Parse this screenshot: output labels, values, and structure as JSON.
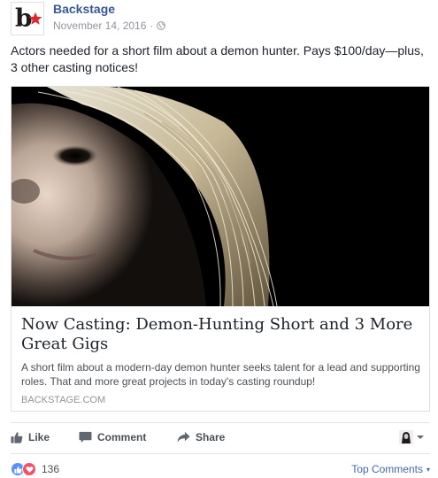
{
  "post": {
    "page_name": "Backstage",
    "date": "November 14, 2016",
    "separator": "·",
    "text": "Actors needed for a short film about a demon hunter. Pays $100/day—plus, 3 other casting notices!",
    "logo_letter": "b"
  },
  "card": {
    "title": "Now Casting: Demon-Hunting Short and 3 More Great Gigs",
    "description": "A short film about a modern-day demon hunter seeks talent for a lead and supporting roles. That and more great projects in today's casting roundup!",
    "domain": "BACKSTAGE.COM"
  },
  "actions": {
    "like": "Like",
    "comment": "Comment",
    "share": "Share"
  },
  "reactions": {
    "count": "136",
    "top_comments": "Top Comments",
    "caret": "▾"
  },
  "colors": {
    "link": "#365899",
    "brand_red": "#e0262f",
    "like_blue": "#5890ff",
    "love_red": "#f25268"
  },
  "icons": [
    "star-icon",
    "globe-icon",
    "like-icon",
    "comment-icon",
    "share-icon",
    "audience-icon",
    "chevron-down-icon",
    "like-reaction-icon",
    "love-reaction-icon"
  ]
}
